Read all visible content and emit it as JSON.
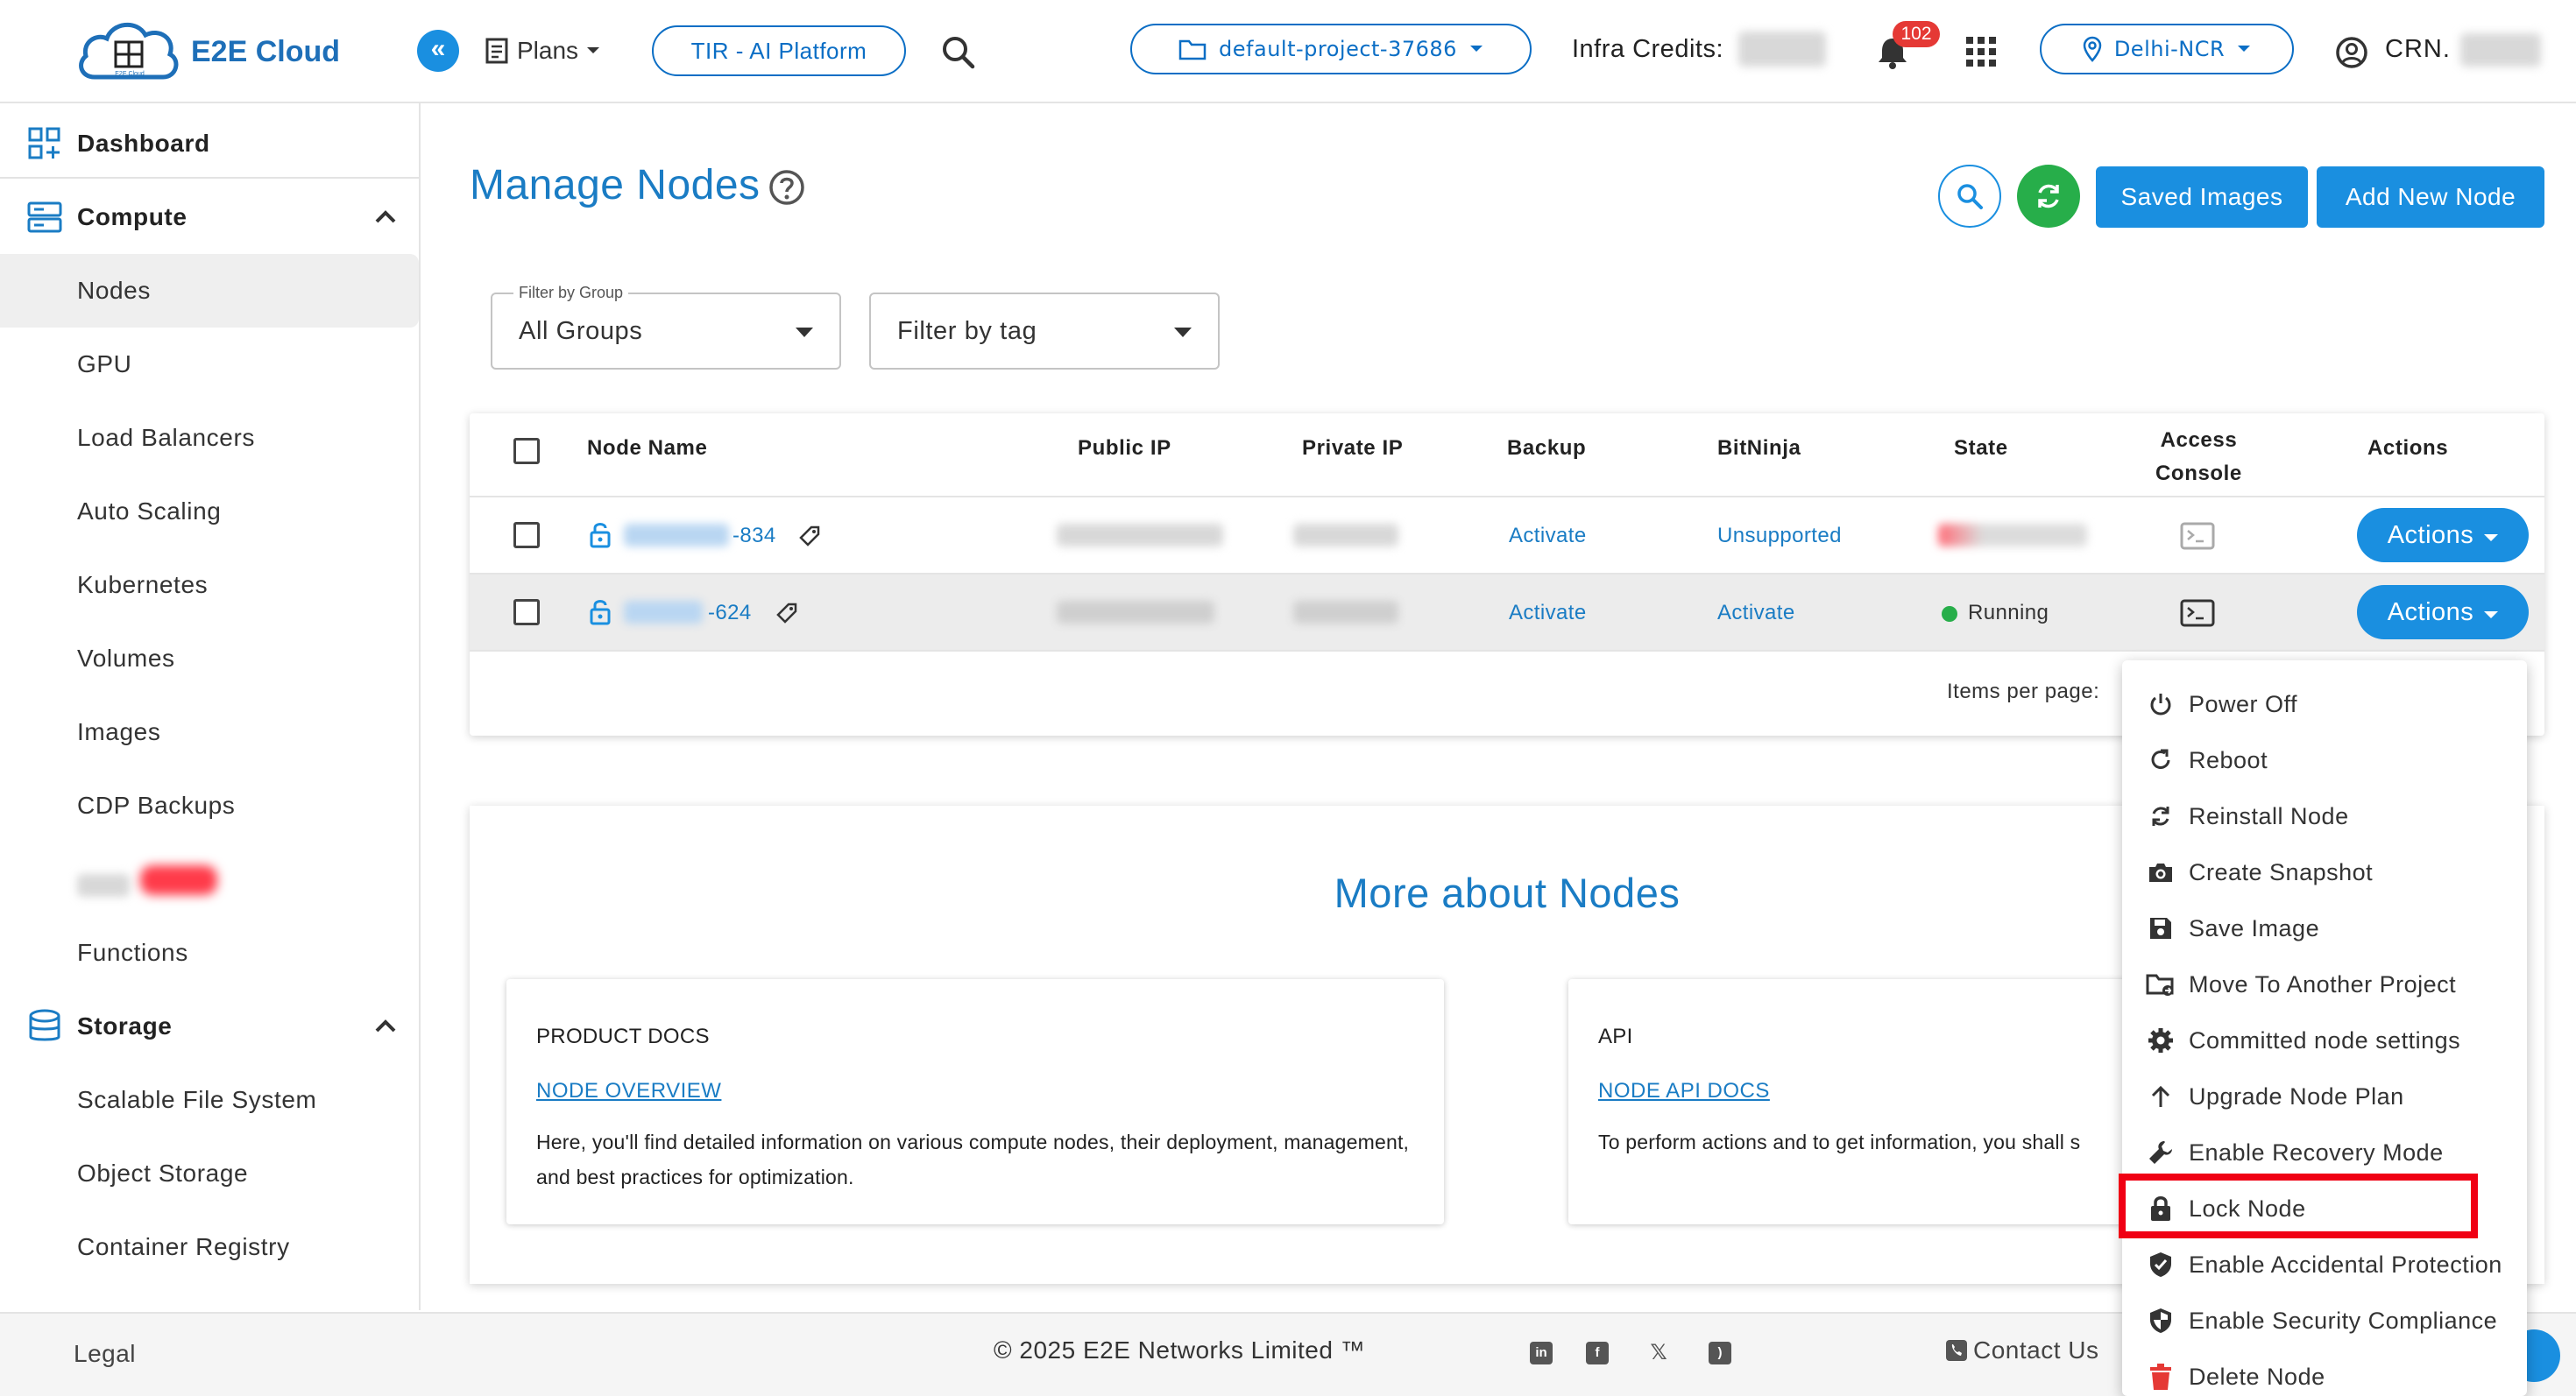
{
  "header": {
    "logo_text": "E2E Cloud",
    "logo_small": "E2E Cloud",
    "plans_label": "Plans",
    "tir_label": "TIR - AI Platform",
    "project_label": "default-project-37686",
    "infra_label": "Infra Credits:",
    "notification_count": "102",
    "region_label": "Delhi-NCR",
    "crn_label": "CRN."
  },
  "sidebar": {
    "dashboard": "Dashboard",
    "compute": "Compute",
    "compute_items": [
      "Nodes",
      "GPU",
      "Load Balancers",
      "Auto Scaling",
      "Kubernetes",
      "Volumes",
      "Images",
      "CDP Backups",
      "",
      "Functions"
    ],
    "storage": "Storage",
    "storage_items": [
      "Scalable File System",
      "Object Storage",
      "Container Registry"
    ]
  },
  "main": {
    "title": "Manage Nodes",
    "saved_images": "Saved Images",
    "add_new_node": "Add New Node",
    "filter_group_legend": "Filter by Group",
    "filter_group_value": "All Groups",
    "filter_tag_value": "Filter by tag"
  },
  "table": {
    "headers": {
      "node_name": "Node Name",
      "public_ip": "Public IP",
      "private_ip": "Private IP",
      "backup": "Backup",
      "bitninja": "BitNinja",
      "state": "State",
      "access_console_1": "Access",
      "access_console_2": "Console",
      "actions": "Actions"
    },
    "rows": [
      {
        "name_suffix": "-834",
        "backup": "Activate",
        "bitninja": "Unsupported",
        "state": "",
        "action": "Actions"
      },
      {
        "name_suffix": "-624",
        "backup": "Activate",
        "bitninja": "Activate",
        "state": "Running",
        "action": "Actions"
      }
    ],
    "items_per_page": "Items per page:"
  },
  "more": {
    "title": "More about Nodes",
    "docs": {
      "heading": "PRODUCT DOCS",
      "link": "NODE OVERVIEW",
      "text": "Here, you'll find detailed information on various compute nodes, their deployment, management, and best practices for optimization."
    },
    "api": {
      "heading": "API",
      "link": "NODE API DOCS",
      "text": "To perform actions and to get information, you shall s"
    }
  },
  "footer": {
    "legal": "Legal",
    "copyright": "© 2025 E2E Networks Limited ™",
    "contact": "Contact Us"
  },
  "actions_menu": [
    {
      "label": "Power Off",
      "icon": "power-icon"
    },
    {
      "label": "Reboot",
      "icon": "reboot-icon"
    },
    {
      "label": "Reinstall Node",
      "icon": "reinstall-icon"
    },
    {
      "label": "Create Snapshot",
      "icon": "camera-icon"
    },
    {
      "label": "Save Image",
      "icon": "save-icon"
    },
    {
      "label": "Move To Another Project",
      "icon": "folder-move-icon"
    },
    {
      "label": "Committed node settings",
      "icon": "gear-icon"
    },
    {
      "label": "Upgrade Node Plan",
      "icon": "arrow-up-icon"
    },
    {
      "label": "Enable Recovery Mode",
      "icon": "wrench-icon"
    },
    {
      "label": "Lock Node",
      "icon": "lock-icon"
    },
    {
      "label": "Enable Accidental Protection",
      "icon": "shield-check-icon"
    },
    {
      "label": "Enable Security Compliance",
      "icon": "shield-half-icon"
    },
    {
      "label": "Delete Node",
      "icon": "trash-icon"
    }
  ],
  "colors": {
    "accent": "#1a8fe0",
    "title_blue": "#1a7cc4",
    "running_green": "#27ae4a",
    "highlight_red": "#f00014",
    "badge_red": "#e53935"
  }
}
